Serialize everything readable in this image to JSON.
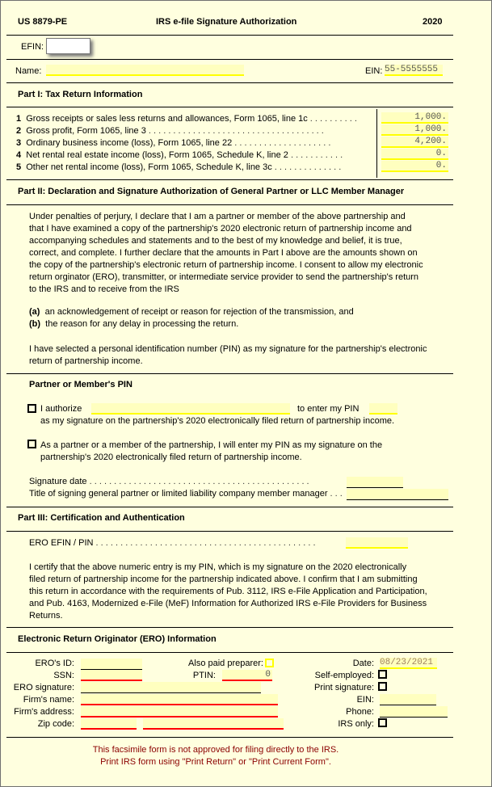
{
  "header": {
    "form_id": "US 8879-PE",
    "title": "IRS e-file Signature Authorization",
    "year": "2020"
  },
  "efin": {
    "label": "EFIN:",
    "value": ""
  },
  "name_row": {
    "name_label": "Name:",
    "name_value": "",
    "ein_label": "EIN:",
    "ein_value": "55-5555555"
  },
  "part1": {
    "heading": "Part I:  Tax Return Information",
    "lines": [
      {
        "num": "1",
        "label": "Gross receipts or sales less returns and allowances,  Form 1065,  line 1c",
        "dots": " . . . . . . . . . .",
        "value": "1,000."
      },
      {
        "num": "2",
        "label": "Gross profit,  Form 1065,  line 3",
        "dots": " . . . . . . . . . . . . . . . . . . . . . . . . . . . . . . . . . . . .",
        "value": "1,000."
      },
      {
        "num": "3",
        "label": "Ordinary business income  (loss),  Form 1065,  line 22",
        "dots": "  . . . . . . . . . . . . . . . . . . . .",
        "value": "4,200."
      },
      {
        "num": "4",
        "label": "Net rental real estate income  (loss),  Form 1065,  Schedule K,  line 2",
        "dots": "  . . . . . . . . . . .",
        "value": "0."
      },
      {
        "num": "5",
        "label": "Other net rental income  (loss),  Form 1065,  Schedule K,  line 3c",
        "dots": "  . . . . . . . . . . . . . .",
        "value": "0."
      }
    ]
  },
  "part2": {
    "heading": "Part II:  Declaration and Signature Authorization of General Partner or LLC Member Manager",
    "declaration_lines": [
      "Under penalties of perjury,  I declare that I am a partner or member of the above partnership and",
      "that I have examined a copy of the partnership's 2020 electronic return of partnership income and",
      "accompanying schedules and statements and to the best of my knowledge and belief,  it is true,",
      "correct,  and complete.  I further declare that the amounts in Part I above are the amounts shown on",
      "the copy of the partnership's electronic return of partnership income.  I consent to allow my electronic",
      "return orginator  (ERO),  transmitter,  or intermediate service provider to send the partnership's return",
      "to the IRS and to receive from the IRS"
    ],
    "item_a_label": "(a)",
    "item_a_text": "an acknowledgement of receipt or reason for rejection of the transmission,  and",
    "item_b_label": "(b)",
    "item_b_text": "the reason for any delay in processing the return.",
    "pin_statement_lines": [
      "I have selected a personal identification number  (PIN)  as my signature for the partnership's electronic",
      "return of partnership income."
    ]
  },
  "pin_section": {
    "heading": "Partner or Member's PIN",
    "option1_prefix": "I authorize",
    "option1_ero_value": "",
    "option1_mid": "to enter my PIN",
    "option1_pin_value": "",
    "option1_line2": "as my signature on the partnership's 2020 electronically filed return of partnership income.",
    "option1_checked": false,
    "option2_line1": "As a partner or a member of the partnership,  I will enter my PIN as my signature on the",
    "option2_line2": "partnership's 2020 electronically filed return of partnership income.",
    "option2_checked": false,
    "signature_date_label": "Signature date",
    "signature_date_dots": "  . . . . . . . . . . . . . . . . . . . . . . . . . . . . . . . . . . . . . . . . . . . . .",
    "signature_date_value": "",
    "title_label": "Title of signing general partner or limited liability company member manager",
    "title_dots": "  . . .",
    "title_value": ""
  },
  "part3": {
    "heading": "Part III:  Certification and Authentication",
    "ero_efin_label": "ERO EFIN / PIN",
    "ero_efin_dots": " . . . . . . . . . . . . . . . . . . . . . . . . . . . . . . . . . . . . . . . . . . . . .",
    "ero_efin_value": "",
    "cert_lines": [
      "I certify that the above numeric entry is my PIN,  which is my signature on the 2020 electronically",
      "filed return of partnership income for the partnership indicated above.  I confirm that I am submitting",
      "this return in accordance with the requirements of Pub. 3112,  IRS e-File Application and Participation,",
      "and Pub. 4163,  Modernized e-File  (MeF)  Information for Authorized IRS e-File Providers for Business",
      "Returns."
    ]
  },
  "ero": {
    "heading": "Electronic Return Originator  (ERO)  Information",
    "ero_id_label": "ERO's ID:",
    "ero_id_value": "",
    "ssn_label": "SSN:",
    "ssn_value": "",
    "ero_signature_label": "ERO signature:",
    "ero_signature_value": "",
    "firm_name_label": "Firm's name:",
    "firm_name_value": "",
    "firm_address_label": "Firm's address:",
    "firm_address_value": "",
    "zip_label": "Zip code:",
    "zip_value": "",
    "zip_ext_value": "",
    "also_paid_label": "Also paid preparer:",
    "also_paid_checked": false,
    "ptin_label": "PTIN:",
    "ptin_value": "0",
    "date_label": "Date:",
    "date_value": "08/23/2021",
    "self_employed_label": "Self-employed:",
    "self_employed_checked": false,
    "print_signature_label": "Print signature:",
    "print_signature_checked": false,
    "ein_label": "EIN:",
    "ein_value": "",
    "phone_label": "Phone:",
    "phone_value": "",
    "irs_only_label": "IRS only:",
    "irs_only_checked": false
  },
  "footer": {
    "line1": "This facsimile form is not approved for filing directly to the IRS.",
    "line2": "Print IRS form using \"Print Return\" or \"Print Current Form\"."
  },
  "colors": {
    "background": "#ffffdf",
    "field_fill": "#ffffbf",
    "field_underline": "#ffff00",
    "required_underline": "#ff0000",
    "footer_text": "#8b0000"
  }
}
